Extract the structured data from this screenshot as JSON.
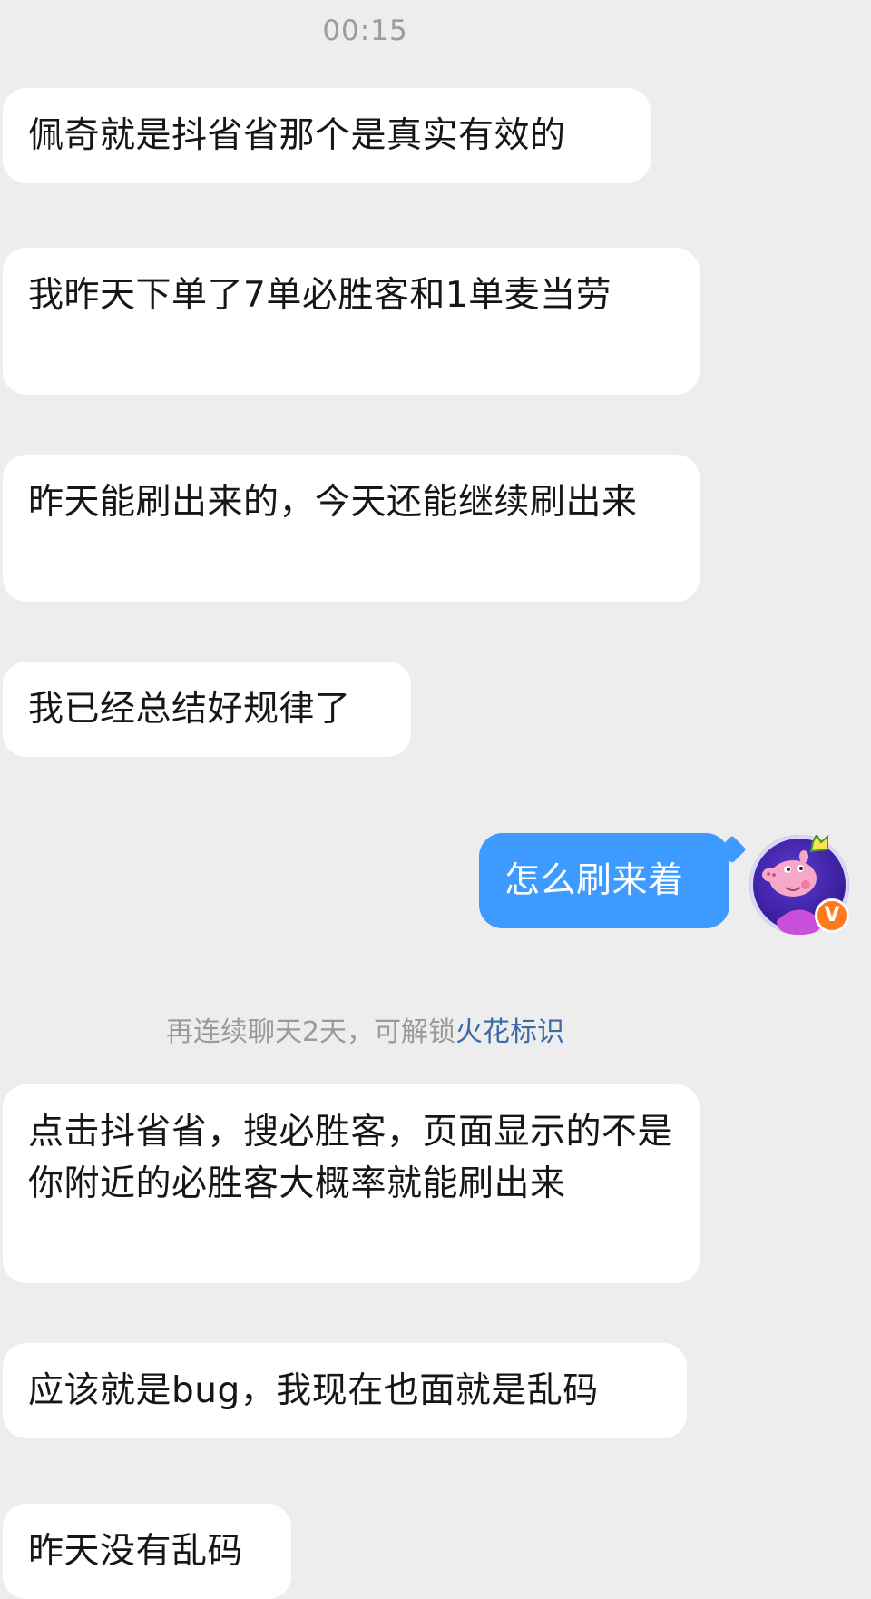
{
  "chat": {
    "timestamp": "00:15",
    "messages": [
      {
        "side": "left",
        "text": "佩奇就是抖省省那个是真实有效的"
      },
      {
        "side": "left",
        "text": "我昨天下单了7单必胜客和1单麦当劳"
      },
      {
        "side": "left",
        "text": "昨天能刷出来的，今天还能继续刷出来"
      },
      {
        "side": "left",
        "text": "我已经总结好规律了"
      },
      {
        "side": "right",
        "text": "怎么刷来着"
      },
      {
        "side": "left",
        "text": "点击抖省省，搜必胜客，页面显示的不是你附近的必胜客大概率就能刷出来"
      },
      {
        "side": "left",
        "text": "应该就是bug，我现在也面就是乱码"
      },
      {
        "side": "left",
        "text": "昨天没有乱码"
      }
    ],
    "system_notice": {
      "prefix": "再连续聊天2天，可解锁",
      "link": "火花标识"
    },
    "avatar": {
      "icon": "peppa-pig-avatar-icon",
      "badge": "V",
      "badge_color": "#ff7a1a"
    }
  },
  "colors": {
    "background": "#ededed",
    "received_bubble": "#ffffff",
    "sent_bubble": "#3d9bff",
    "link": "#3a6aa8"
  }
}
